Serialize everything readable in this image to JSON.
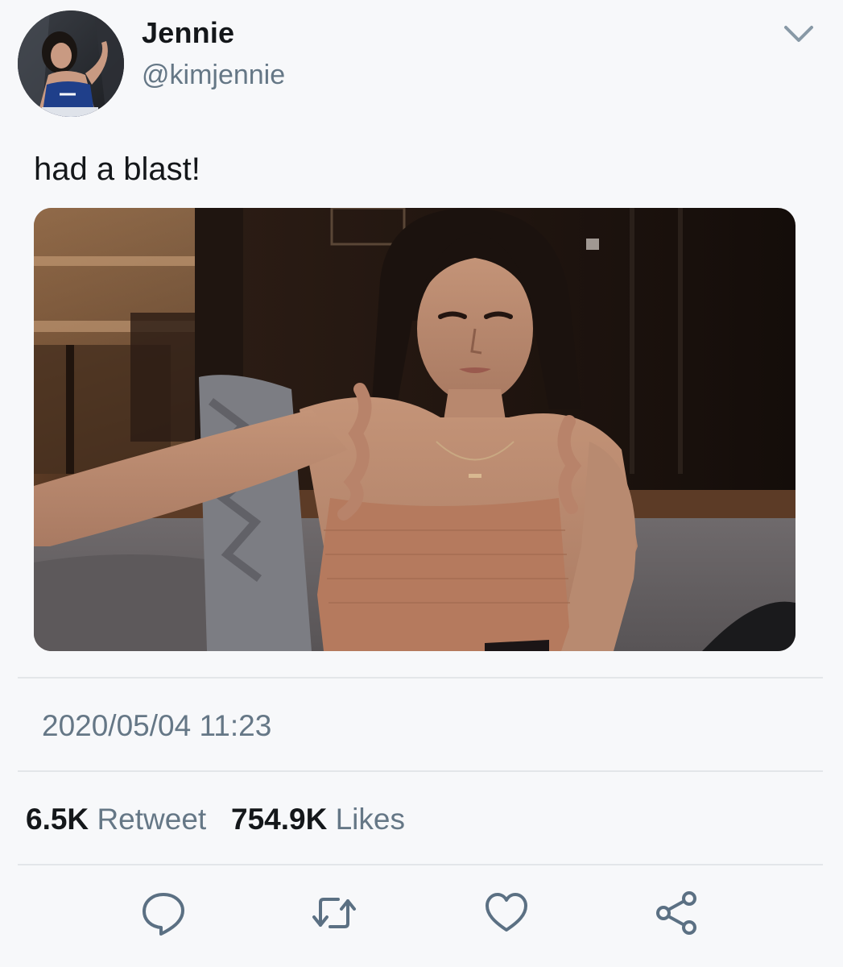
{
  "tweet": {
    "author": {
      "display_name": "Jennie",
      "handle": "@kimjennie"
    },
    "text": "had a blast!",
    "timestamp": "2020/05/04 11:23",
    "stats": {
      "retweets_count": "6.5K",
      "retweets_label": "Retweet",
      "likes_count": "754.9K",
      "likes_label": "Likes"
    }
  },
  "actions": {
    "reply_icon": "reply-icon",
    "retweet_icon": "retweet-icon",
    "like_icon": "heart-icon",
    "share_icon": "share-icon"
  },
  "colors": {
    "background": "#f7f8fa",
    "text_primary": "#14171a",
    "text_secondary": "#657786",
    "icon": "#5b7083",
    "divider": "#e3e6e9"
  }
}
